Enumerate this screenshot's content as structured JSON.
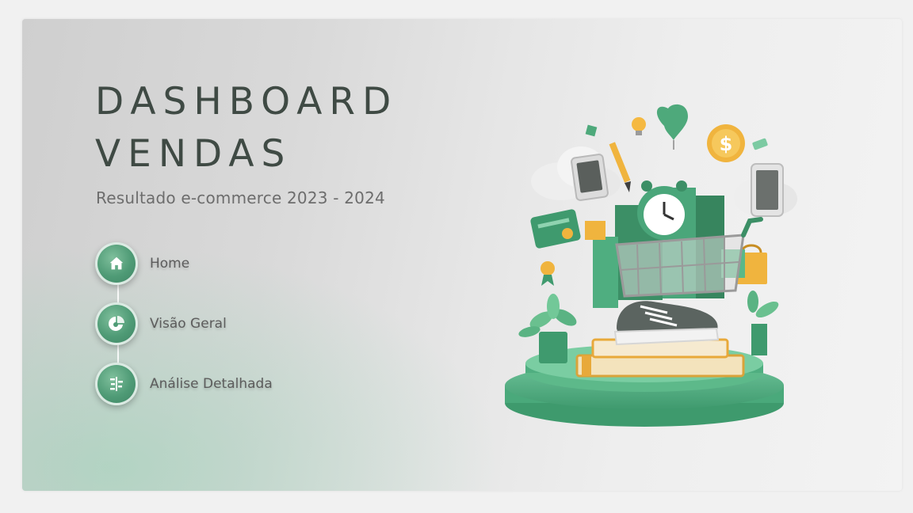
{
  "header": {
    "title_line1": "DASHBOARD",
    "title_line2": "VENDAS",
    "subtitle": "Resultado e-commerce 2023 - 2024"
  },
  "nav": {
    "items": [
      {
        "label": "Home",
        "icon": "home-icon"
      },
      {
        "label": "Visão Geral",
        "icon": "pie-chart-icon"
      },
      {
        "label": "Análise Detalhada",
        "icon": "analysis-icon"
      }
    ]
  },
  "colors": {
    "accent": "#4f9b76",
    "accent_dark": "#3f8564",
    "title": "#3f4a44",
    "text": "#5c5c5c",
    "gold": "#e8a93a"
  },
  "illustration": {
    "icon": "shopping-cart-illustration"
  }
}
